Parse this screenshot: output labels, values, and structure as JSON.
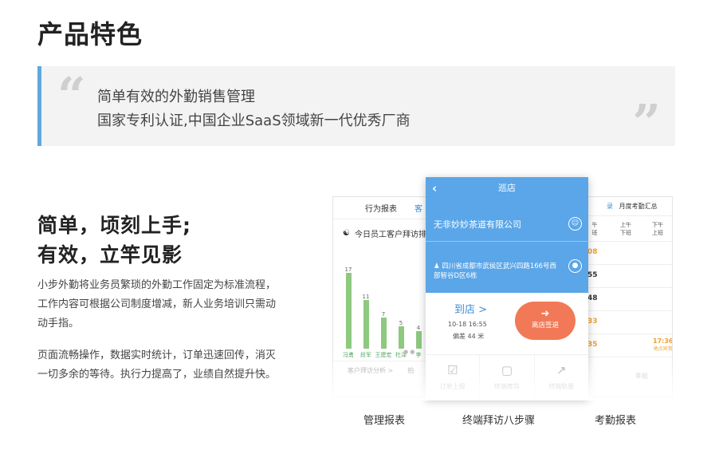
{
  "page": {
    "title": "产品特色"
  },
  "quote": {
    "open_mark": "“",
    "close_mark": "”",
    "line1": "简单有效的外勤销售管理",
    "line2": "国家专利认证,中国企业SaaS领域新一代优秀厂商"
  },
  "feature": {
    "headline_line1": "简单，顷刻上手;",
    "headline_line2": "有效，立竿见影",
    "paragraph1": "小步外勤将业务员繁琐的外勤工作固定为标准流程，工作内容可根据公司制度增减，新人业务培训只需动动手指。",
    "paragraph2": "页面流畅操作，数据实时统计，订单迅速回传，消灭一切多余的等待。执行力提高了，业绩自然提升快。"
  },
  "screens": {
    "management": {
      "tabs": [
        "行为报表",
        "客"
      ],
      "title": "今日员工客户拜访排",
      "bars": [
        {
          "name": "冯勇",
          "value": 17
        },
        {
          "name": "段军",
          "value": 11
        },
        {
          "name": "王建宏",
          "value": 7
        },
        {
          "name": "杜泽",
          "value": 5
        },
        {
          "name": "李",
          "value": 4
        }
      ],
      "bar_color": "#8dc97f",
      "footer": [
        "客户拜访分析 >",
        "拍"
      ]
    },
    "visit": {
      "nav_title": "巡店",
      "company": "无非妙妙茶道有限公司",
      "address": "四川省成都市武侯区武兴四路166号西部智谷D区6栋",
      "arrive_label": "到店 >",
      "arrive_time": "10-18 16:55",
      "deviation": "偏差 44 米",
      "leave_button": "离店签退",
      "steps": [
        "订单上报",
        "终端库存",
        "终端轨量"
      ],
      "header_color": "#5aa6e8",
      "button_color": "#f27957"
    },
    "attendance": {
      "tabs": [
        "录",
        "月度考勤汇总"
      ],
      "columns": [
        "午\n班",
        "上午\n下班",
        "下午\n上班"
      ],
      "rows": [
        "08",
        "55",
        "48",
        "33",
        "35"
      ],
      "side_value": "17:36",
      "side_label": "地点异常",
      "footer": "季报"
    }
  },
  "captions": [
    "管理报表",
    "终端拜访八步骤",
    "考勤报表"
  ]
}
